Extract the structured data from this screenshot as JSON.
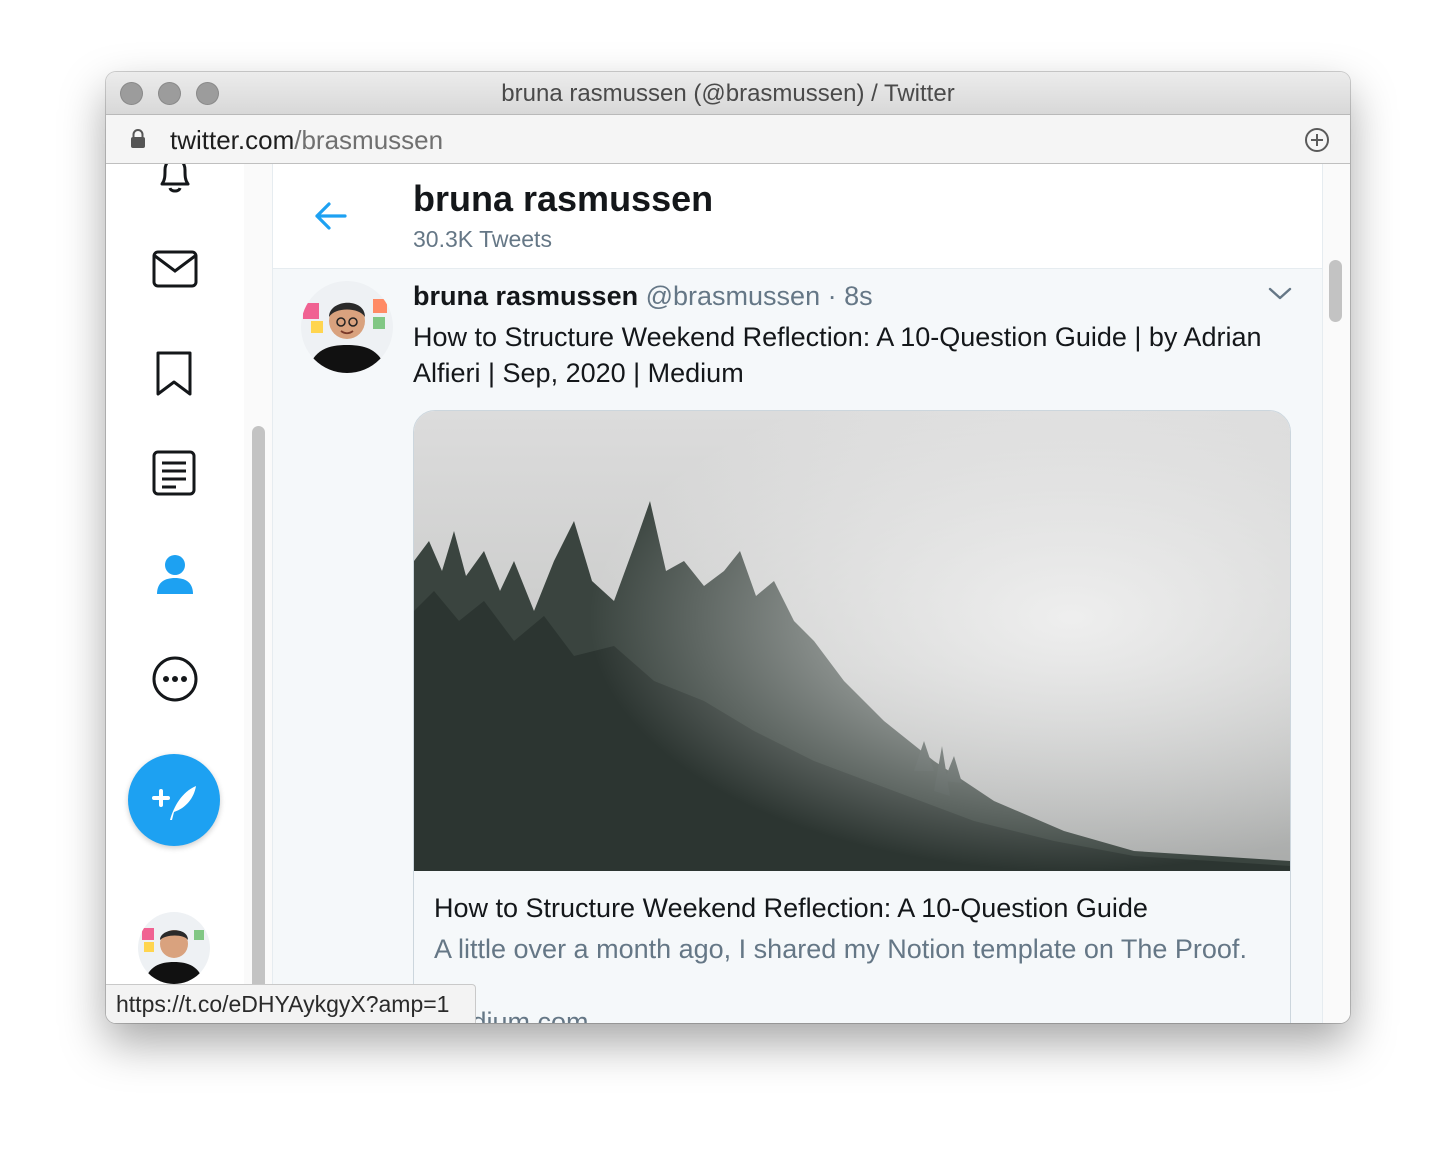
{
  "window": {
    "title": "bruna rasmussen (@brasmussen) / Twitter"
  },
  "address_bar": {
    "domain": "twitter.com",
    "path": "/brasmussen",
    "lock_icon": "lock-icon",
    "new_tab_icon": "plus-circle-icon"
  },
  "sidebar": {
    "items": [
      {
        "icon": "bell-icon",
        "label": "Notifications"
      },
      {
        "icon": "mail-icon",
        "label": "Messages"
      },
      {
        "icon": "bookmark-icon",
        "label": "Bookmarks"
      },
      {
        "icon": "list-icon",
        "label": "Lists"
      },
      {
        "icon": "profile-icon",
        "label": "Profile",
        "active": true
      },
      {
        "icon": "more-icon",
        "label": "More"
      }
    ],
    "compose_icon": "compose-feather-icon",
    "accent_color": "#1da1f2"
  },
  "profile_header": {
    "name": "bruna rasmussen",
    "tweet_count": "30.3K Tweets"
  },
  "tweet": {
    "author_name": "bruna rasmussen",
    "handle": "@brasmussen",
    "separator": "·",
    "time": "8s",
    "text": "How to Structure Weekend Reflection: A 10-Question Guide | by Adrian Alfieri | Sep, 2020 | Medium",
    "card": {
      "title": "How to Structure Weekend Reflection: A 10-Question Guide",
      "description": "A little over a month ago, I shared my Notion template on The Proof.",
      "domain": "medium.com"
    }
  },
  "status_bar": {
    "url": "https://t.co/eDHYAykgyX?amp=1"
  }
}
